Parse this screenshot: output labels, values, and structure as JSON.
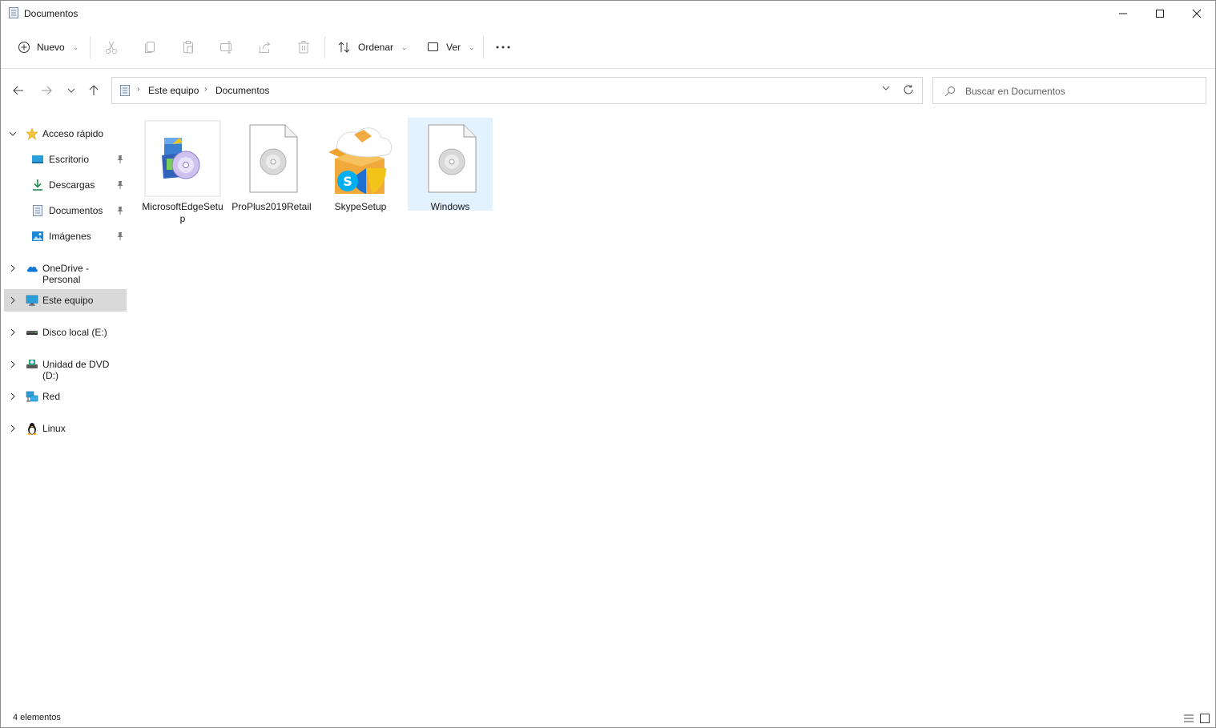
{
  "window": {
    "title": "Documentos"
  },
  "toolbar": {
    "new_label": "Nuevo",
    "sort_label": "Ordenar",
    "view_label": "Ver"
  },
  "address": {
    "crumbs": [
      "Este equipo",
      "Documentos"
    ]
  },
  "search": {
    "placeholder": "Buscar en Documentos"
  },
  "sidebar": {
    "items": [
      {
        "label": "Acceso rápido",
        "icon": "star-icon",
        "color": "#f2c43d"
      },
      {
        "label": "Escritorio",
        "icon": "desktop-icon",
        "pinned": true
      },
      {
        "label": "Descargas",
        "icon": "download-icon",
        "pinned": true
      },
      {
        "label": "Documentos",
        "icon": "document-icon",
        "pinned": true
      },
      {
        "label": "Imágenes",
        "icon": "pictures-icon",
        "pinned": true
      },
      {
        "label": "OneDrive - Personal",
        "icon": "onedrive-icon"
      },
      {
        "label": "Este equipo",
        "icon": "computer-icon",
        "selected": true
      },
      {
        "label": "Disco local (E:)",
        "icon": "drive-icon"
      },
      {
        "label": "Unidad de DVD (D:)",
        "icon": "dvd-icon"
      },
      {
        "label": "Red",
        "icon": "network-icon"
      },
      {
        "label": "Linux",
        "icon": "linux-icon"
      }
    ]
  },
  "files": [
    {
      "name": "MicrosoftEdgeSetup",
      "icon": "installer-icon"
    },
    {
      "name": "ProPlus2019Retail",
      "icon": "disc-image-icon"
    },
    {
      "name": "SkypeSetup",
      "icon": "skype-installer-icon"
    },
    {
      "name": "Windows",
      "icon": "disc-image-icon",
      "selected": true
    }
  ],
  "status": {
    "count": "4 elementos"
  },
  "colors": {
    "selection": "#cce8ff",
    "sidebar_selected": "#d9d9d9",
    "accent": "#0078d4"
  }
}
